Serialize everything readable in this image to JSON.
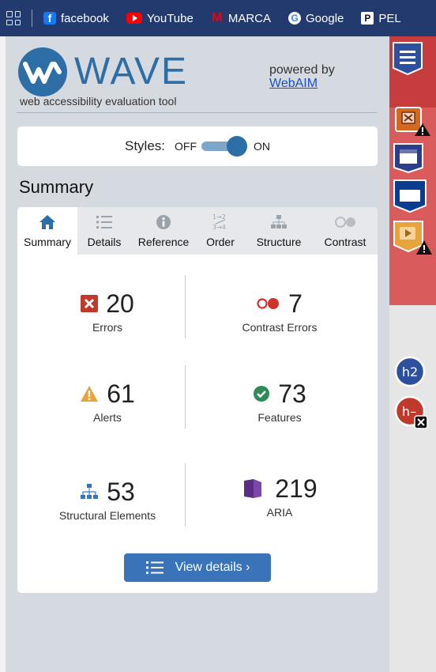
{
  "bookmarks": [
    {
      "label": "facebook",
      "icon": "facebook-icon"
    },
    {
      "label": "YouTube",
      "icon": "youtube-icon"
    },
    {
      "label": "MARCA",
      "icon": "marca-icon"
    },
    {
      "label": "Google",
      "icon": "google-icon"
    },
    {
      "label": "PEL",
      "icon": "p-icon"
    }
  ],
  "logo": {
    "word": "WAVE",
    "tagline": "web accessibility evaluation tool",
    "powered_by": "powered by",
    "webaim": "WebAIM"
  },
  "styles": {
    "label": "Styles:",
    "off": "OFF",
    "on": "ON",
    "state": "on"
  },
  "summary_heading": "Summary",
  "tabs": [
    {
      "label": "Summary",
      "icon": "home-icon",
      "active": true
    },
    {
      "label": "Details",
      "icon": "list-icon",
      "active": false
    },
    {
      "label": "Reference",
      "icon": "info-icon",
      "active": false
    },
    {
      "label": "Order",
      "icon": "order-icon",
      "active": false
    },
    {
      "label": "Structure",
      "icon": "structure-icon",
      "active": false
    },
    {
      "label": "Contrast",
      "icon": "contrast-icon",
      "active": false
    }
  ],
  "stats": {
    "errors": {
      "count": "20",
      "label": "Errors"
    },
    "contrast_errors": {
      "count": "7",
      "label": "Contrast Errors"
    },
    "alerts": {
      "count": "61",
      "label": "Alerts"
    },
    "features": {
      "count": "73",
      "label": "Features"
    },
    "structural": {
      "count": "53",
      "label": "Structural Elements"
    },
    "aria": {
      "count": "219",
      "label": "ARIA"
    }
  },
  "view_details": "View details ›",
  "page_strip_labels": {
    "h2": "h2",
    "h_empty": "h–"
  },
  "colors": {
    "wave_blue": "#2e6ea6",
    "error_red": "#c0392b",
    "alert_orange": "#e8a33d",
    "feature_green": "#2e8b57",
    "aria_purple": "#5b2c83"
  }
}
